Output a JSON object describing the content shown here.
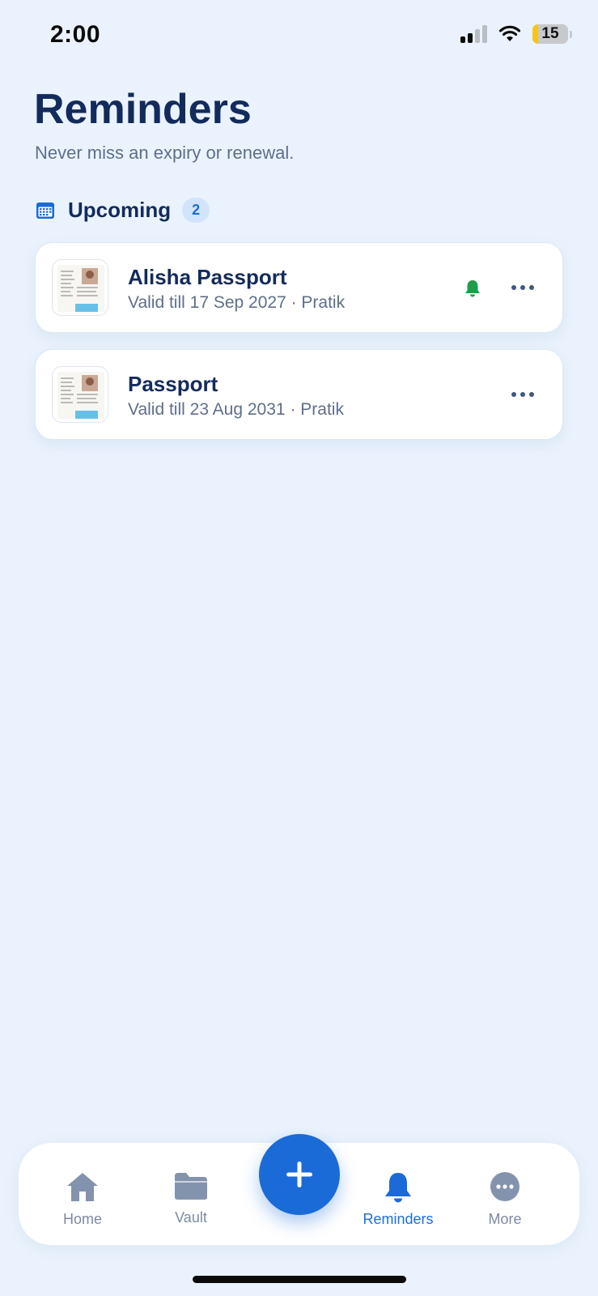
{
  "status_bar": {
    "time": "2:00",
    "battery": "15",
    "battery_level": 0.15
  },
  "header": {
    "title": "Reminders",
    "subtitle": "Never miss an expiry or renewal."
  },
  "section": {
    "icon": "calendar-icon",
    "title": "Upcoming",
    "count": "2"
  },
  "reminders": [
    {
      "title": "Alisha Passport",
      "valid": "Valid till 17 Sep 2027",
      "owner": "· Pratik",
      "bell_icon": "bell-icon",
      "bell_color": "#1f9e4a"
    },
    {
      "title": "Passport",
      "valid": "Valid till 23 Aug 2031",
      "owner": "· Pratik"
    }
  ],
  "nav": {
    "items": [
      {
        "label": "Home",
        "icon": "home-icon"
      },
      {
        "label": "Vault",
        "icon": "folder-icon"
      },
      {
        "label": "Reminders",
        "icon": "bell-icon",
        "active": true
      },
      {
        "label": "More",
        "icon": "more-icon"
      }
    ],
    "fab_icon": "plus-icon"
  },
  "colors": {
    "accent": "#1a6ad8",
    "background": "#eaf3fd",
    "title": "#132b5c",
    "muted": "#5d6f8c",
    "bell_active": "#1f9e4a"
  }
}
